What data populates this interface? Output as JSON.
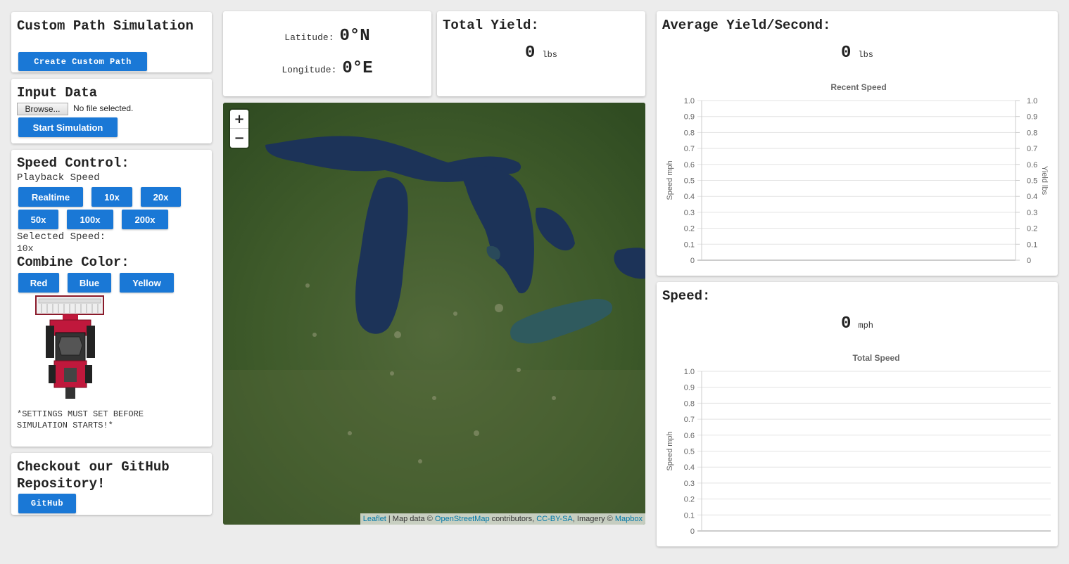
{
  "custom_path": {
    "title": "Custom Path Simulation",
    "button": "Create Custom Path"
  },
  "input_data": {
    "title": "Input Data",
    "browse_label": "Browse...",
    "file_status": "No file selected.",
    "start_button": "Start Simulation"
  },
  "speed_control": {
    "title": "Speed Control:",
    "playback_label": "Playback Speed",
    "speeds": [
      "Realtime",
      "10x",
      "20x",
      "50x",
      "100x",
      "200x"
    ],
    "selected_label": "Selected Speed:",
    "selected_value": "10x",
    "color_title": "Combine Color:",
    "colors": [
      "Red",
      "Blue",
      "Yellow"
    ],
    "warning_line1": "*SETTINGS MUST SET BEFORE",
    "warning_line2": "SIMULATION STARTS!*"
  },
  "github": {
    "title_line1": "Checkout our GitHub",
    "title_line2": "Repository!",
    "button": "GitHub"
  },
  "coords": {
    "lat_label": "Latitude:",
    "lat_value": "0°N",
    "lon_label": "Longitude:",
    "lon_value": "0°E"
  },
  "total_yield": {
    "title": "Total Yield:",
    "value": "0",
    "unit": "lbs"
  },
  "avg_yield": {
    "title": "Average Yield/Second:",
    "value": "0",
    "unit": "lbs"
  },
  "speed": {
    "title": "Speed:",
    "value": "0",
    "unit": "mph"
  },
  "map": {
    "zoom_in": "+",
    "zoom_out": "−",
    "attr_leaflet": "Leaflet",
    "attr_mapdata": "| Map data ©",
    "attr_osm": "OpenStreetMap",
    "attr_contrib": "contributors,",
    "attr_license": "CC-BY-SA",
    "attr_imagery": ", Imagery ©",
    "attr_mapbox": "Mapbox"
  },
  "colors": {
    "button": "#1a78d6",
    "combine_red": "#c0183c"
  },
  "chart_data": [
    {
      "type": "line",
      "title": "Recent Speed",
      "ylabel": "Speed mph",
      "y2label": "Yield lbs",
      "ylim": [
        0,
        1
      ],
      "y2lim": [
        0,
        1
      ],
      "yticks": [
        "1.0",
        "0.9",
        "0.8",
        "0.7",
        "0.6",
        "0.5",
        "0.4",
        "0.3",
        "0.2",
        "0.1",
        "0"
      ],
      "series": []
    },
    {
      "type": "line",
      "title": "Total Speed",
      "ylabel": "Speed mph",
      "ylim": [
        0,
        1
      ],
      "yticks": [
        "1.0",
        "0.9",
        "0.8",
        "0.7",
        "0.6",
        "0.5",
        "0.4",
        "0.3",
        "0.2",
        "0.1",
        "0"
      ],
      "series": []
    }
  ]
}
